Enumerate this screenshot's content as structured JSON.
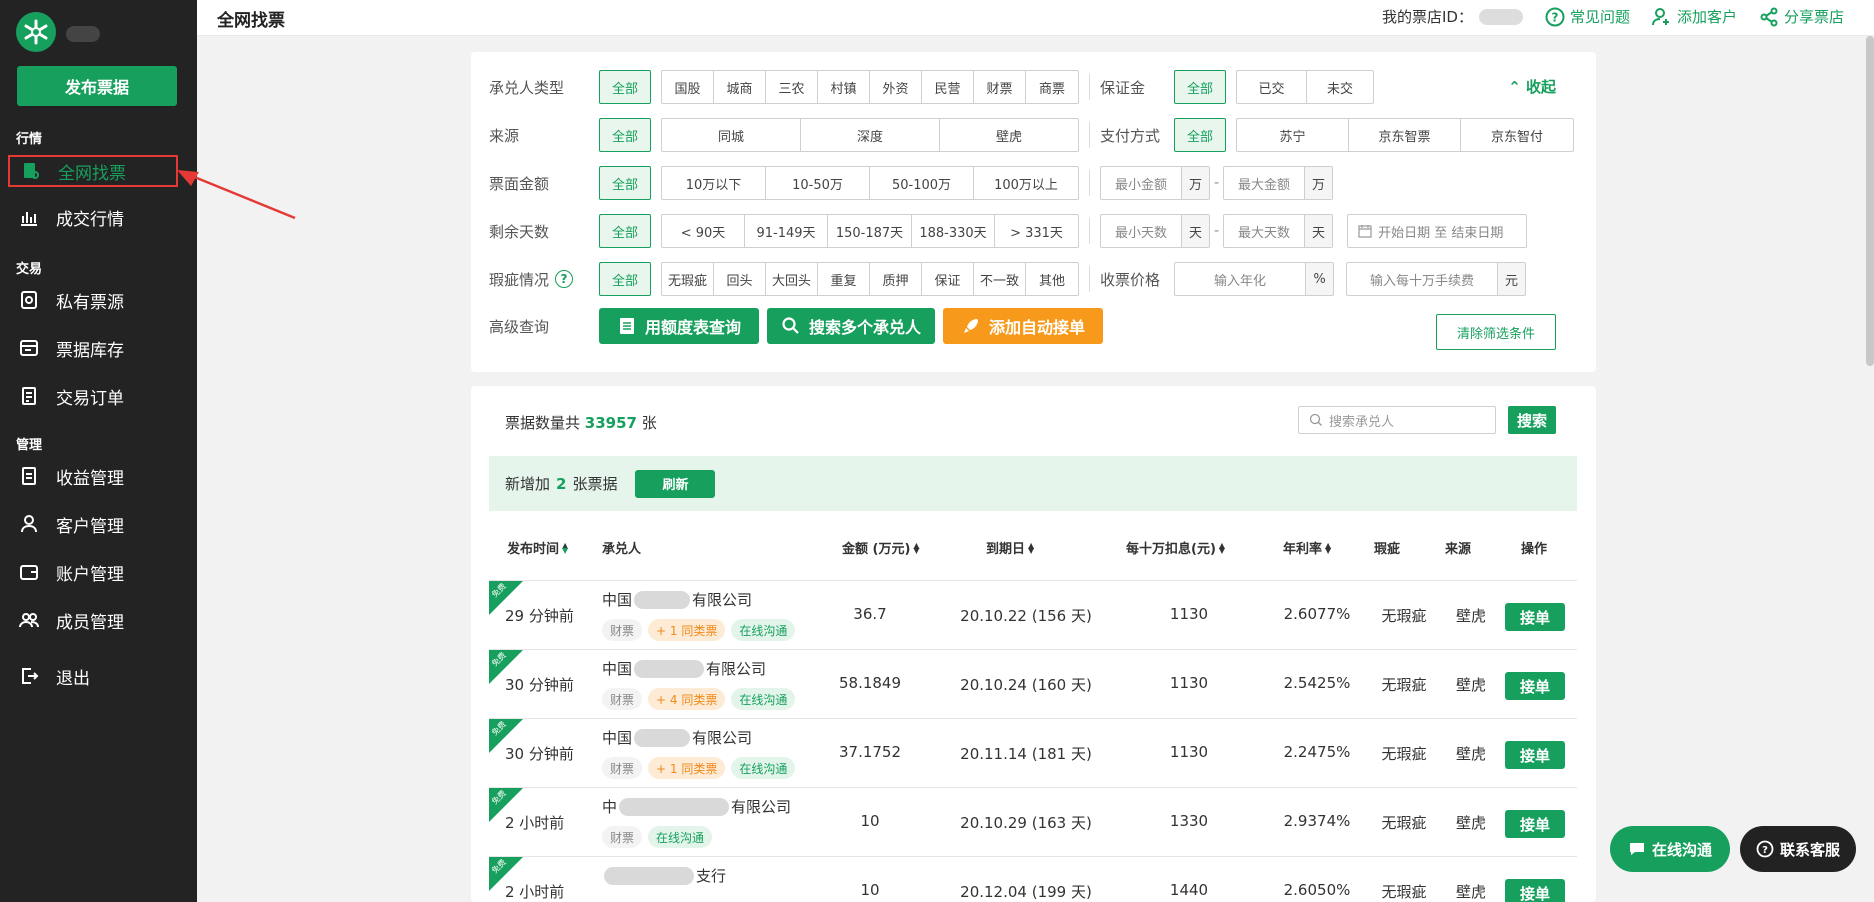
{
  "sidebar": {
    "publish_label": "发布票据",
    "groups": [
      "行情",
      "交易",
      "管理"
    ],
    "items": [
      {
        "label": "全网找票",
        "icon": "ticket-search-icon"
      },
      {
        "label": "成交行情",
        "icon": "chart-icon"
      },
      {
        "label": "私有票源",
        "icon": "safe-icon"
      },
      {
        "label": "票据库存",
        "icon": "inventory-icon"
      },
      {
        "label": "交易订单",
        "icon": "order-icon"
      },
      {
        "label": "收益管理",
        "icon": "earnings-icon"
      },
      {
        "label": "客户管理",
        "icon": "customer-icon"
      },
      {
        "label": "账户管理",
        "icon": "wallet-icon"
      },
      {
        "label": "成员管理",
        "icon": "members-icon"
      },
      {
        "label": "退出",
        "icon": "logout-icon"
      }
    ]
  },
  "topbar": {
    "title": "全网找票",
    "shop_id_label": "我的票店ID：",
    "faq": "常见问题",
    "add_customer": "添加客户",
    "share_shop": "分享票店"
  },
  "filters": {
    "all_label": "全部",
    "collapse": "收起",
    "acceptor_type": {
      "label": "承兑人类型",
      "options": [
        "国股",
        "城商",
        "三农",
        "村镇",
        "外资",
        "民营",
        "财票",
        "商票"
      ]
    },
    "deposit": {
      "label": "保证金",
      "options": [
        "已交",
        "未交"
      ]
    },
    "source": {
      "label": "来源",
      "options": [
        "同城",
        "深度",
        "壁虎"
      ]
    },
    "payment": {
      "label": "支付方式",
      "options": [
        "苏宁",
        "京东智票",
        "京东智付"
      ]
    },
    "amount": {
      "label": "票面金额",
      "options": [
        "10万以下",
        "10-50万",
        "50-100万",
        "100万以上"
      ],
      "min_placeholder": "最小金额",
      "max_placeholder": "最大金额",
      "unit": "万"
    },
    "days": {
      "label": "剩余天数",
      "options": [
        "< 90天",
        "91-149天",
        "150-187天",
        "188-330天",
        "> 331天"
      ],
      "min_placeholder": "最小天数",
      "max_placeholder": "最大天数",
      "unit": "天",
      "date_placeholder": "开始日期  至  结束日期"
    },
    "flaw": {
      "label": "瑕疵情况",
      "help": "?",
      "options": [
        "无瑕疵",
        "回头",
        "大回头",
        "重复",
        "质押",
        "保证",
        "不一致",
        "其他"
      ]
    },
    "price": {
      "label": "收票价格",
      "rate_placeholder": "输入年化",
      "rate_unit": "%",
      "fee_placeholder": "输入每十万手续费",
      "fee_unit": "元"
    },
    "advanced": {
      "label": "高级查询",
      "btn_quota": "用额度表查询",
      "btn_multi": "搜索多个承兑人",
      "btn_auto": "添加自动接单",
      "clear": "清除筛选条件"
    }
  },
  "list": {
    "count_prefix": "票据数量共",
    "count": "33957",
    "count_suffix": "张",
    "search_placeholder": "搜索承兑人",
    "search_btn": "搜索",
    "new_prefix": "新增加",
    "new_count": "2",
    "new_suffix": "张票据",
    "refresh": "刷新",
    "columns": [
      "发布时间",
      "承兑人",
      "金额 (万元)",
      "到期日",
      "每十万扣息(元)",
      "年利率",
      "瑕疵",
      "来源",
      "操作"
    ],
    "badge": "免费",
    "accept_label": "接单",
    "rows": [
      {
        "time": "29 分钟前",
        "acc_pre": "中国",
        "acc_post": "有限公司",
        "tags": [
          [
            "财票",
            "grey"
          ],
          [
            "+ 1 同类票",
            "orange"
          ],
          [
            "在线沟通",
            "green"
          ]
        ],
        "amount": "36.7",
        "due": "20.10.22 (156 天)",
        "fee": "1130",
        "rate": "2.6077%",
        "flaw": "无瑕疵",
        "source": "壁虎"
      },
      {
        "time": "30 分钟前",
        "acc_pre": "中国",
        "acc_post": "有限公司",
        "tags": [
          [
            "财票",
            "grey"
          ],
          [
            "+ 4 同类票",
            "orange"
          ],
          [
            "在线沟通",
            "green"
          ]
        ],
        "amount": "58.1849",
        "due": "20.10.24 (160 天)",
        "fee": "1130",
        "rate": "2.5425%",
        "flaw": "无瑕疵",
        "source": "壁虎"
      },
      {
        "time": "30 分钟前",
        "acc_pre": "中国",
        "acc_post": "有限公司",
        "tags": [
          [
            "财票",
            "grey"
          ],
          [
            "+ 1 同类票",
            "orange"
          ],
          [
            "在线沟通",
            "green"
          ]
        ],
        "amount": "37.1752",
        "due": "20.11.14 (181 天)",
        "fee": "1130",
        "rate": "2.2475%",
        "flaw": "无瑕疵",
        "source": "壁虎"
      },
      {
        "time": "2 小时前",
        "acc_pre": "中",
        "acc_post": "有限公司",
        "tags": [
          [
            "财票",
            "grey"
          ],
          [
            "在线沟通",
            "green"
          ]
        ],
        "amount": "10",
        "due": "20.10.29 (163 天)",
        "fee": "1330",
        "rate": "2.9374%",
        "flaw": "无瑕疵",
        "source": "壁虎"
      },
      {
        "time": "2 小时前",
        "acc_pre": "",
        "acc_post": "支行",
        "tags": [],
        "amount": "10",
        "due": "20.12.04 (199 天)",
        "fee": "1440",
        "rate": "2.6050%",
        "flaw": "无瑕疵",
        "source": "壁虎"
      }
    ]
  },
  "floating": {
    "online": "在线沟通",
    "service": "联系客服"
  }
}
